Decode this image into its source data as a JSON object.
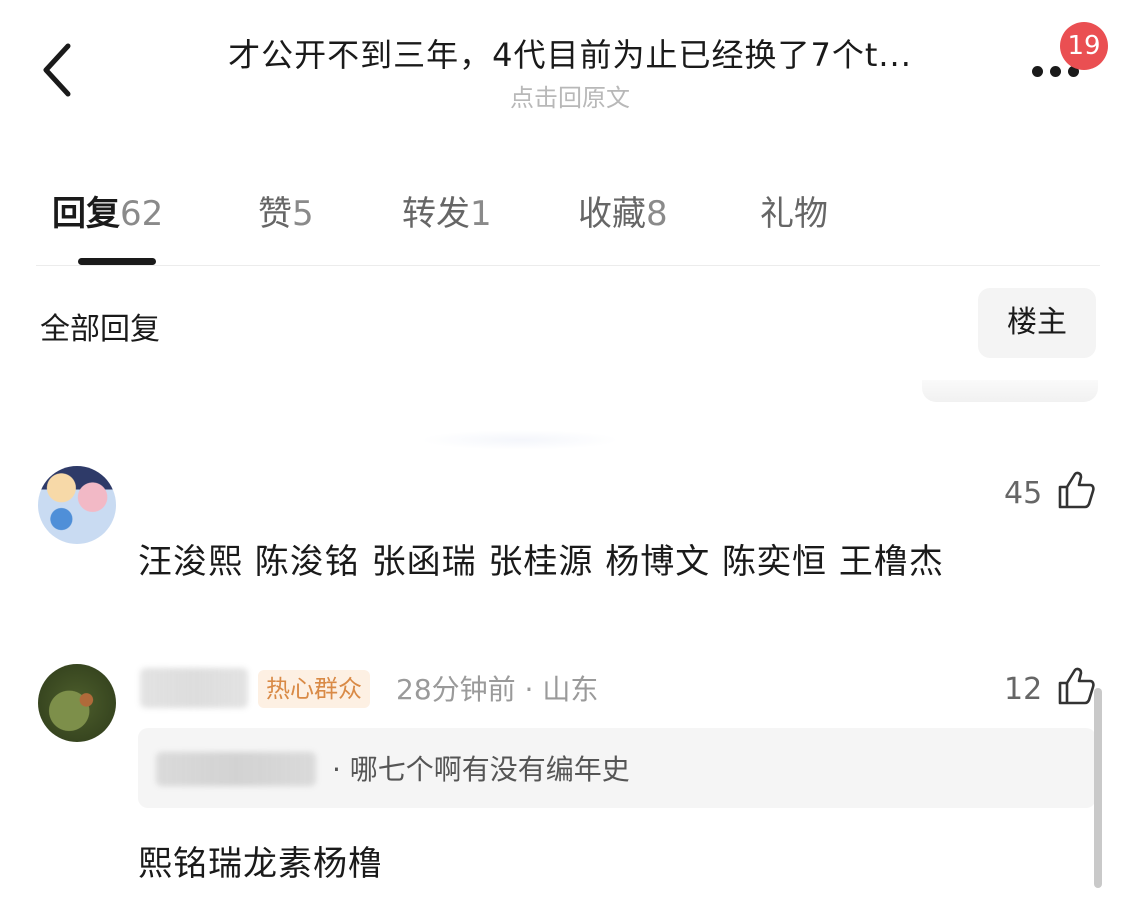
{
  "header": {
    "title": "才公开不到三年，4代目前为止已经换了7个t...",
    "subtitle": "点击回原文",
    "notification_count": "19"
  },
  "tabs": [
    {
      "label": "回复",
      "count": "62",
      "active": true
    },
    {
      "label": "赞",
      "count": "5",
      "active": false
    },
    {
      "label": "转发",
      "count": "1",
      "active": false
    },
    {
      "label": "收藏",
      "count": "8",
      "active": false
    },
    {
      "label": "礼物",
      "count": "",
      "active": false
    }
  ],
  "section": {
    "title": "全部回复",
    "filter_label": "楼主"
  },
  "comments": [
    {
      "likes": "45",
      "text": "汪浚熙 陈浚铭 张函瑞 张桂源 杨博文 陈奕恒 王橹杰"
    },
    {
      "tag": "热心群众",
      "meta": "28分钟前 · 山东",
      "likes": "12",
      "quote": "· 哪七个啊有没有编年史",
      "text": "熙铭瑞龙素杨橹"
    }
  ],
  "colors": {
    "badge": "#ea4f52",
    "tag_bg": "#fdf0e3",
    "tag_text": "#d98a46",
    "active_text": "#1a1a1a",
    "muted_text": "#9a9a9a"
  }
}
